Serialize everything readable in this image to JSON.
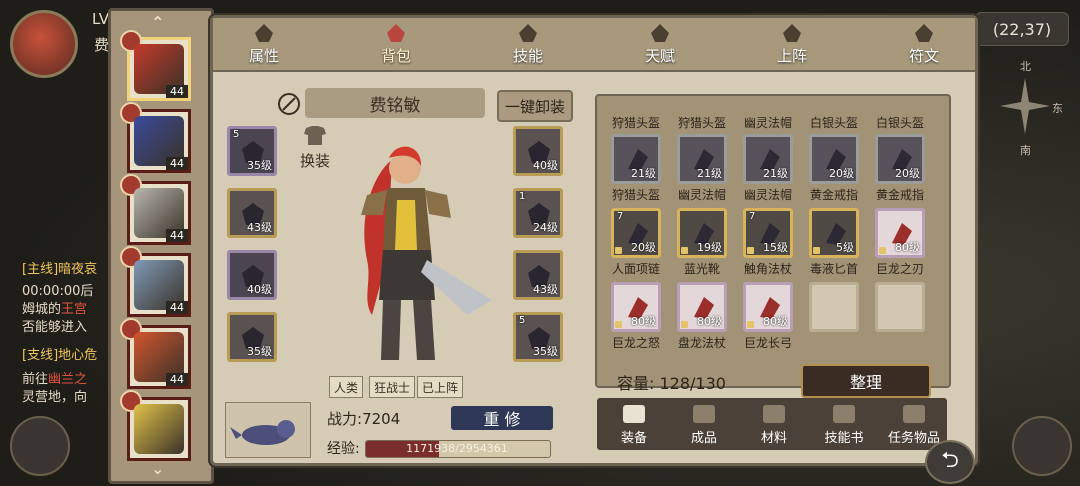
{
  "hud": {
    "level_prefix": "LV",
    "player_name_partial": "费",
    "coords": "(22,37)",
    "compass_north": "北",
    "compass_east": "东",
    "compass_south": "南",
    "main_quest": "[主线]暗夜哀",
    "main_quest_line2": "00:00:00后",
    "main_quest_line3_a": "姆城的",
    "main_quest_line3_b": "王宫",
    "main_quest_line4": "否能够进入",
    "side_quest": "[支线]地心危",
    "side_quest_line2_a": "前往",
    "side_quest_line2_b": "幽兰之",
    "side_quest_line3": "灵营地，向"
  },
  "tabs": [
    {
      "label": "属性",
      "icon": "flame-icon"
    },
    {
      "label": "背包",
      "icon": "bag-icon"
    },
    {
      "label": "技能",
      "icon": "book-icon"
    },
    {
      "label": "天赋",
      "icon": "eye-icon"
    },
    {
      "label": "上阵",
      "icon": "crossed-swords-icon"
    },
    {
      "label": "符文",
      "icon": "shrine-icon"
    }
  ],
  "active_tab": "背包",
  "characters": [
    {
      "level": "44",
      "color": "#c43a2a",
      "selected": true
    },
    {
      "level": "44",
      "color": "#3a4a9a"
    },
    {
      "level": "44",
      "color": "#b9b7b0"
    },
    {
      "level": "44",
      "color": "#7f9ab6"
    },
    {
      "level": "44",
      "color": "#d2552e"
    },
    {
      "level": "",
      "color": "#e2c24a"
    }
  ],
  "equipment": {
    "hero_name": "费铭敏",
    "unequip_all": "一键卸装",
    "swap_label": "换装",
    "left_slots": [
      {
        "count": "5",
        "level": "35级",
        "purple": true
      },
      {
        "count": "",
        "level": "43级"
      },
      {
        "count": "",
        "level": "40级",
        "purple": true
      },
      {
        "count": "",
        "level": "35级"
      }
    ],
    "right_slots": [
      {
        "count": "",
        "level": "40级"
      },
      {
        "count": "1",
        "level": "24级"
      },
      {
        "count": "",
        "level": "43级"
      },
      {
        "count": "5",
        "level": "35级"
      }
    ],
    "tags": [
      "人类",
      "狂战士",
      "已上阵"
    ],
    "power_label": "战力:",
    "power_value": "7204",
    "reforge": "重 修",
    "exp_label": "经验:",
    "exp_value": "1171938/2954361",
    "exp_progress": 0.397
  },
  "bag": {
    "top_row_labels": [
      "狩猎头盔",
      "狩猎头盔",
      "幽灵法帽",
      "白银头盔",
      "白银头盔"
    ],
    "items": [
      {
        "name": "狩猎头盔",
        "level": "21级",
        "count": "",
        "type": "gray"
      },
      {
        "name": "幽灵法帽",
        "level": "21级",
        "count": "",
        "type": "gray"
      },
      {
        "name": "幽灵法帽",
        "level": "21级",
        "count": "",
        "type": "gray"
      },
      {
        "name": "黄金戒指",
        "level": "20级",
        "count": "",
        "type": "gray"
      },
      {
        "name": "黄金戒指",
        "level": "20级",
        "count": "",
        "type": "gray"
      },
      {
        "name": "人面项链",
        "level": "20级",
        "count": "7",
        "type": "gold"
      },
      {
        "name": "蓝光靴",
        "level": "19级",
        "count": "",
        "type": "gold"
      },
      {
        "name": "触角法杖",
        "level": "15级",
        "count": "7",
        "type": "gold"
      },
      {
        "name": "毒液匕首",
        "level": "5级",
        "count": "",
        "type": "gold"
      },
      {
        "name": "巨龙之刃",
        "level": "80级",
        "count": "",
        "type": "light"
      },
      {
        "name": "巨龙之怒",
        "level": "80级",
        "count": "",
        "type": "light"
      },
      {
        "name": "盘龙法杖",
        "level": "80级",
        "count": "",
        "type": "light"
      },
      {
        "name": "巨龙长弓",
        "level": "80级",
        "count": "",
        "type": "light"
      },
      {
        "name": "",
        "level": "",
        "count": "",
        "type": "empty"
      },
      {
        "name": "",
        "level": "",
        "count": "",
        "type": "empty"
      }
    ],
    "capacity_label": "容量:",
    "capacity_value": "128/130",
    "sort": "整理",
    "bag_tabs": [
      "装备",
      "成品",
      "材料",
      "技能书",
      "任务物品"
    ]
  }
}
